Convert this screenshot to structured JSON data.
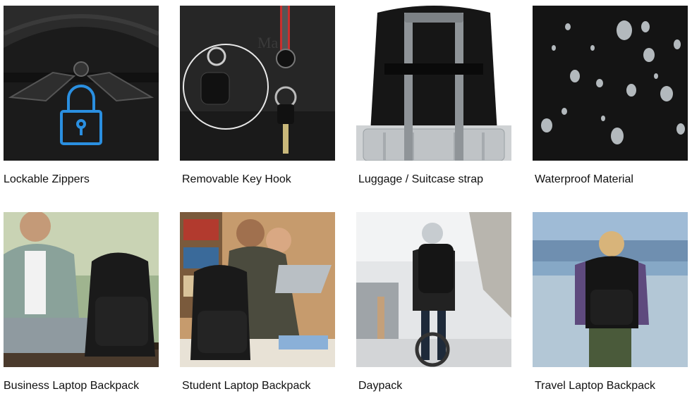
{
  "features": [
    {
      "label": "Lockable Zippers",
      "image_icon": "padlock-icon"
    },
    {
      "label": "Removable Key Hook",
      "image_icon": "key-hook-icon"
    },
    {
      "label": "Luggage / Suitcase strap",
      "image_icon": "luggage-strap-icon"
    },
    {
      "label": "Waterproof Material",
      "image_icon": "water-drops-icon"
    }
  ],
  "uses": [
    {
      "label": "Business Laptop Backpack"
    },
    {
      "label": "Student Laptop Backpack"
    },
    {
      "label": "Daypack"
    },
    {
      "label": "Travel Laptop Backpack"
    }
  ],
  "colors": {
    "lock_icon": "#2a8fe0",
    "backpack": "#1a1a1a"
  }
}
